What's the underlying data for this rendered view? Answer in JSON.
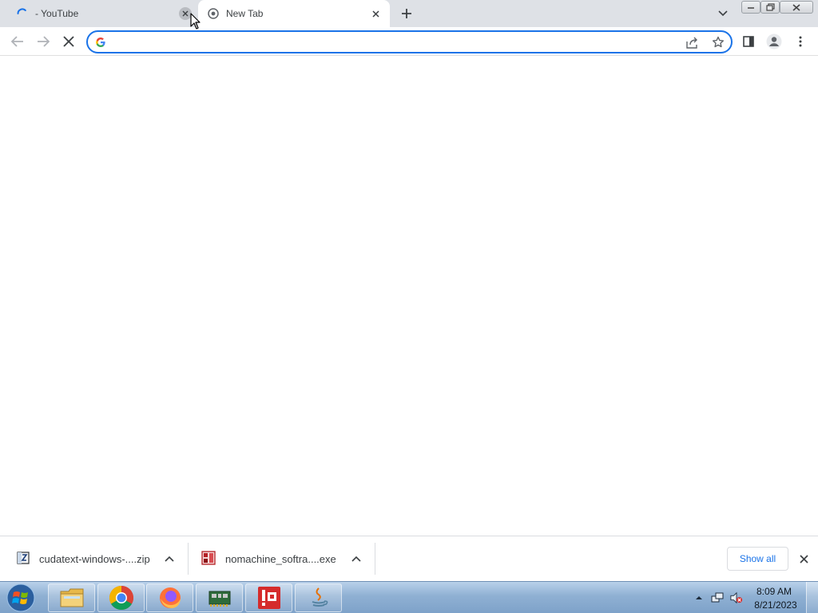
{
  "window": {
    "tabs": [
      {
        "title": "- YouTube",
        "state": "loading",
        "icon": "loading-spinner-icon"
      },
      {
        "title": "New Tab",
        "state": "active",
        "icon": "chrome-newtab-icon"
      }
    ],
    "controls": {
      "minimize": "minimize-icon",
      "maximize": "restore-icon",
      "close": "close-icon"
    }
  },
  "toolbar": {
    "back": "back-arrow-icon",
    "forward": "forward-arrow-icon",
    "stop": "stop-loading-icon",
    "omnibox": {
      "value": "",
      "placeholder": "",
      "icon": "google-g-icon",
      "focused": true
    },
    "share": "share-icon",
    "bookmark": "star-icon",
    "side_panel": "side-panel-icon",
    "profile": "profile-avatar-icon",
    "menu": "kebab-menu-icon",
    "accent_color": "#1a73e8"
  },
  "downloads": {
    "items": [
      {
        "filename": "cudatext-windows-....zip",
        "icon": "zip-archive-icon"
      },
      {
        "filename": "nomachine_softra....exe",
        "icon": "exe-installer-icon"
      }
    ],
    "show_all_label": "Show all"
  },
  "taskbar": {
    "apps": [
      {
        "name": "File Explorer",
        "icon": "folder-icon"
      },
      {
        "name": "Google Chrome",
        "icon": "chrome-icon"
      },
      {
        "name": "Firefox",
        "icon": "firefox-icon"
      },
      {
        "name": "Network tool",
        "icon": "network-card-icon"
      },
      {
        "name": "Red app",
        "icon": "red-app-icon"
      },
      {
        "name": "Java",
        "icon": "java-icon"
      }
    ],
    "clock": {
      "time": "8:09 AM",
      "date": "8/21/2023"
    }
  }
}
